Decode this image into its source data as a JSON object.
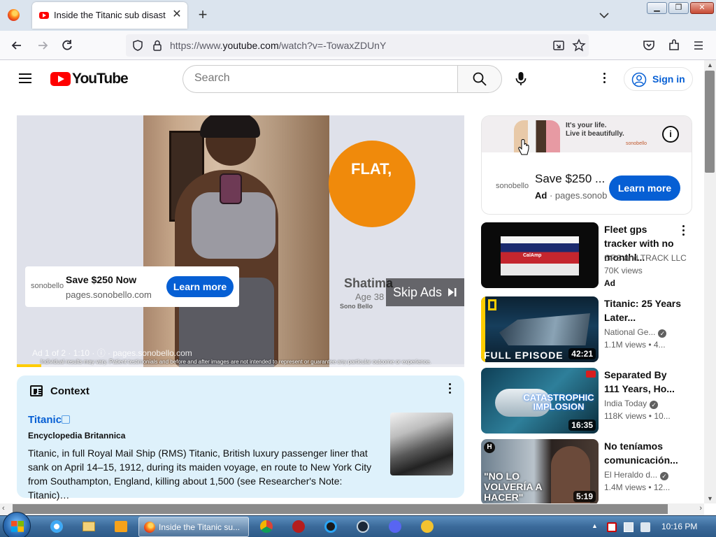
{
  "browser": {
    "tab_title": "Inside the Titanic sub disaster",
    "new_tab_glyph": "+",
    "url_prefix": "https://www.",
    "url_domain": "youtube.com",
    "url_path": "/watch?v=-TowaxZDUnY"
  },
  "youtube": {
    "logo_text": "YouTube",
    "search_placeholder": "Search",
    "sign_in_label": "Sign in"
  },
  "player_ad": {
    "overlay_flat": "FLAT,",
    "person_name": "Shatima",
    "person_age": "Age 38",
    "brand_small": "Sono Bello",
    "card_logo": "sonobello",
    "card_title": "Save $250 Now",
    "card_url": "pages.sonobello.com",
    "card_button": "Learn more",
    "skip_label": "Skip Ads",
    "ad_counter": "Ad 1 of 2 · 1:10 · ⓘ · pages.sonobello.com",
    "disclaimer": "Individual results may vary. Patient testimonials and before and after images are not intended to represent or guarantee any particular outcome or experience.",
    "progress_fraction": 0.055
  },
  "context": {
    "heading": "Context",
    "link_title": "Titanic",
    "source": "Encyclopedia Britannica",
    "body": "Titanic, in full Royal Mail Ship (RMS) Titanic, British luxury passenger liner that sank on April 14–15, 1912, during its maiden voyage, en route to New York City from Southampton, England, killing about 1,500 (see Researcher's Note: Titanic)…"
  },
  "side_ad": {
    "banner_line1": "It's your life.",
    "banner_line2": "Live it beautifully.",
    "banner_brand": "sonobello",
    "info_glyph": "i",
    "logo": "sonobello",
    "title": "Save $250 ...",
    "ad_badge": "Ad",
    "url": "· pages.sonob",
    "button": "Learn more"
  },
  "recommendations": [
    {
      "title": "Fleet gps tracker with no monthl...",
      "channel": "GPS and TRACK LLC",
      "meta": "70K views",
      "badge": "Ad",
      "duration": "",
      "thumb_overlay": "CalAmp"
    },
    {
      "title": "Titanic: 25 Years Later...",
      "channel": "National Ge...",
      "meta": "1.1M views  • 4...",
      "duration": "42:21",
      "thumb_overlay": "FULL EPISODE"
    },
    {
      "title": "Separated By 111 Years, Ho...",
      "channel": "India Today",
      "meta": "118K views  • 10...",
      "duration": "16:35",
      "thumb_overlay": "CATASTROPHIC IMPLOSION"
    },
    {
      "title": "No teníamos comunicación...",
      "channel": "El Heraldo d...",
      "meta": "1.4M views  • 12...",
      "duration": "5:19",
      "thumb_overlay": "\"NO LO VOLVERÍA A HACER\""
    }
  ],
  "taskbar": {
    "active_window": "Inside the Titanic su...",
    "clock": "10:16 PM"
  },
  "colors": {
    "youtube_red": "#ff0000",
    "link_blue": "#065fd4",
    "context_bg": "#def1fb",
    "ad_orange": "#f08a0b",
    "progress_yellow": "#ffcc00"
  },
  "icons": [
    "firefox-icon",
    "youtube-favicon",
    "close-icon",
    "chevron-down-icon",
    "back-arrow-icon",
    "forward-arrow-icon",
    "reload-icon",
    "shield-icon",
    "lock-icon",
    "picture-in-picture-icon",
    "star-icon",
    "pocket-icon",
    "extensions-icon",
    "menu-icon",
    "hamburger-icon",
    "search-icon",
    "microphone-icon",
    "more-vert-icon",
    "account-icon",
    "skip-icon",
    "external-link-icon",
    "info-icon",
    "verified-icon",
    "windows-start-icon"
  ]
}
